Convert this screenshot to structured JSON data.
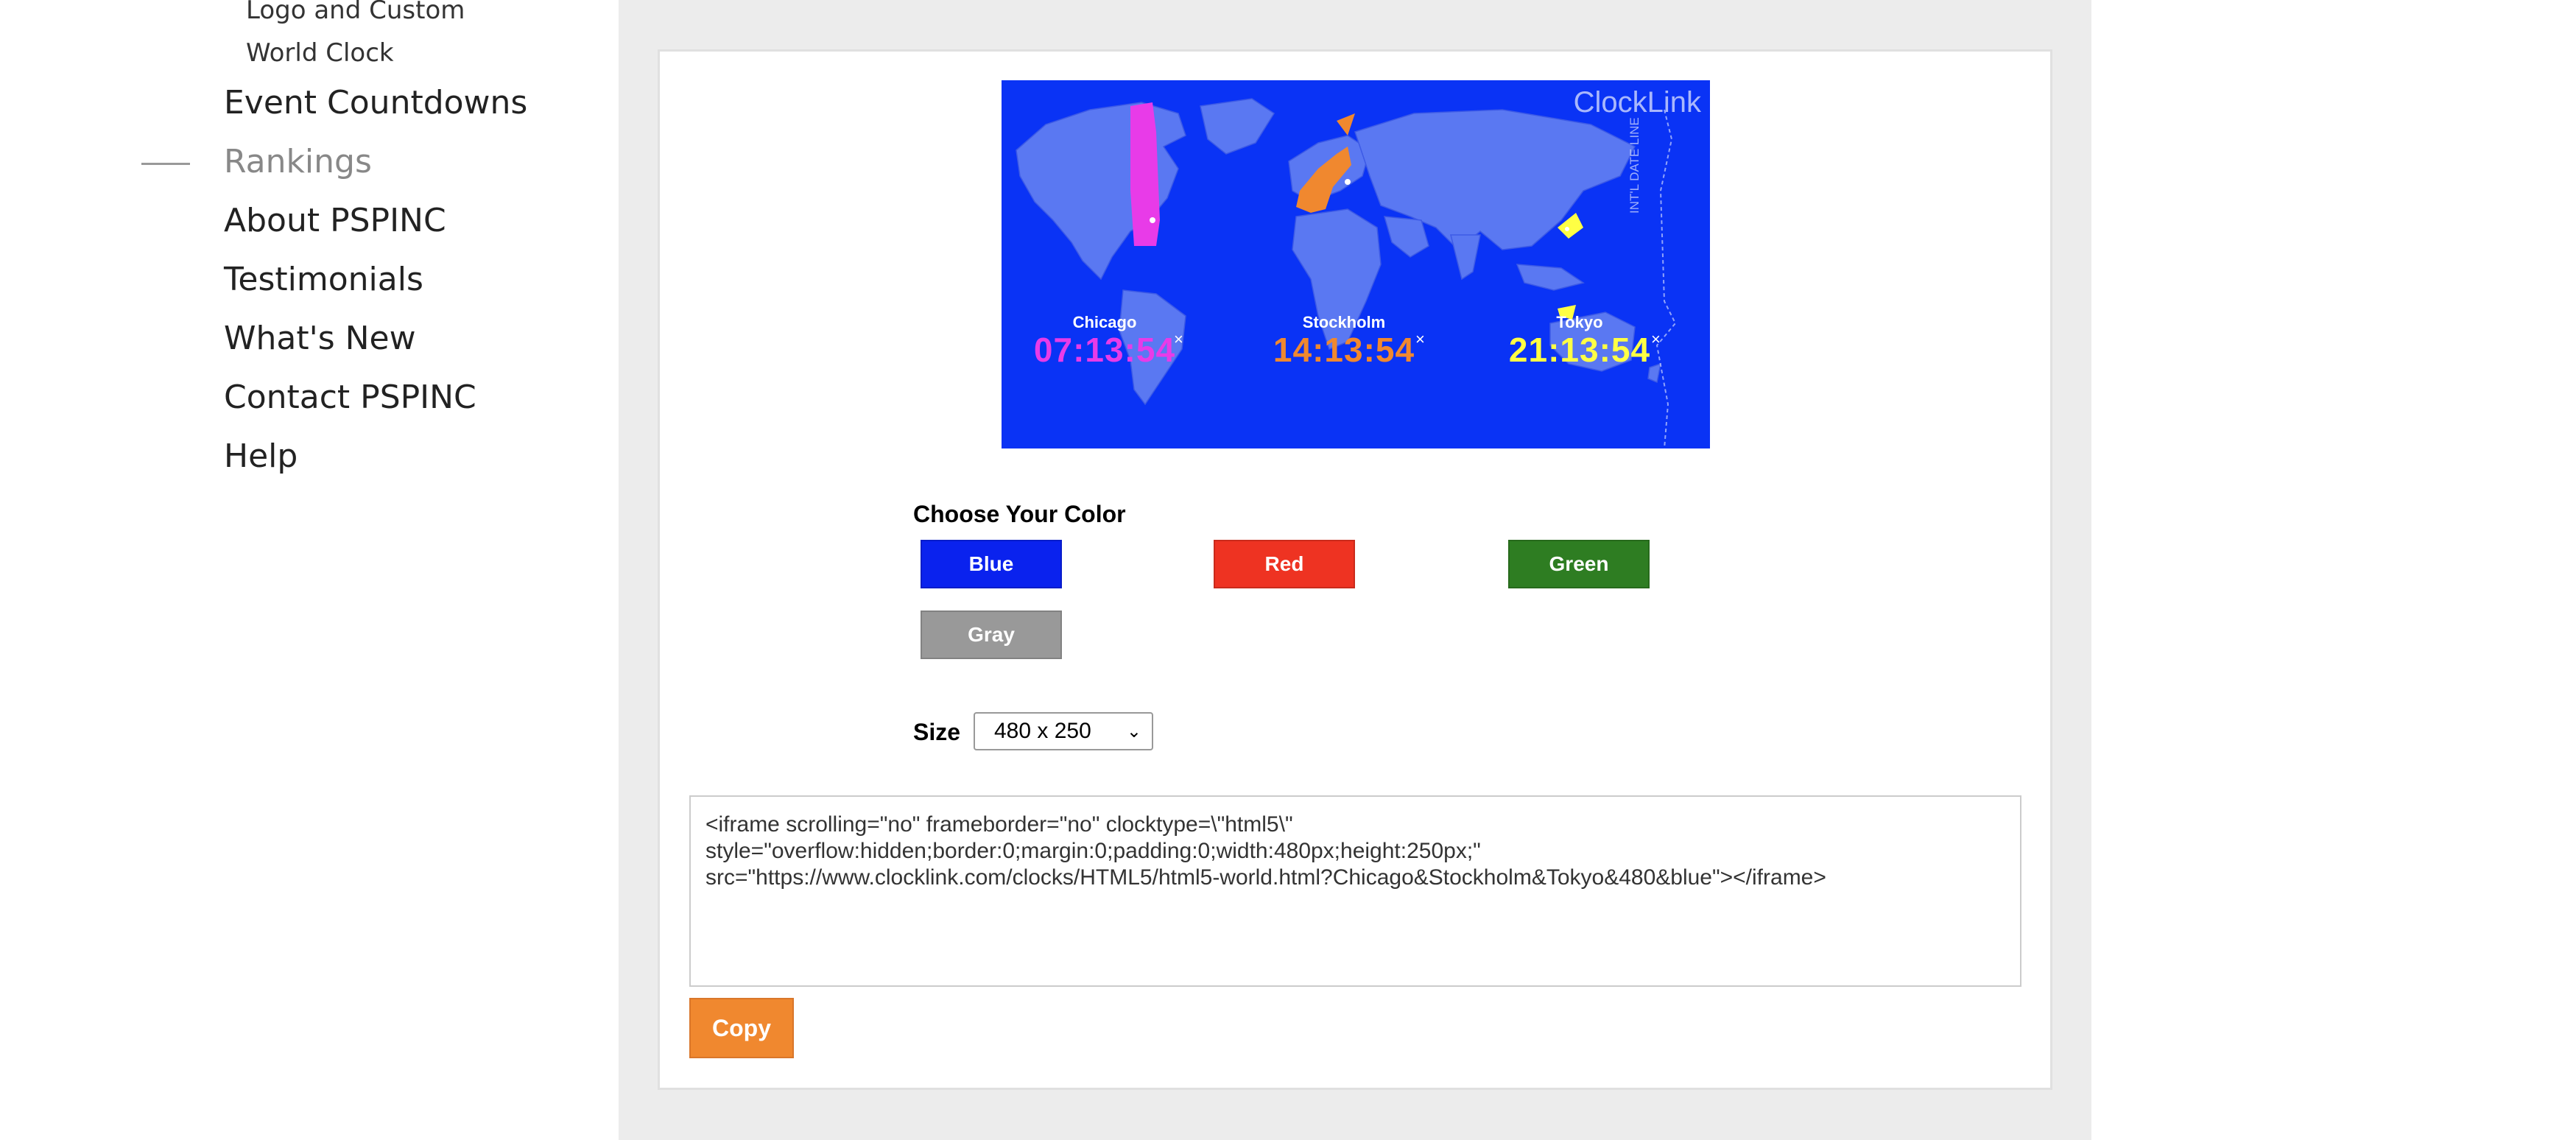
{
  "sidebar": {
    "sub_items": [
      "Logo and Custom",
      "World Clock"
    ],
    "items": [
      {
        "label": "Event Countdowns"
      },
      {
        "label": "Rankings"
      },
      {
        "label": "About PSPINC"
      },
      {
        "label": "Testimonials"
      },
      {
        "label": "What's New"
      },
      {
        "label": "Contact PSPINC"
      },
      {
        "label": "Help"
      }
    ]
  },
  "clock": {
    "brand": "ClockLink",
    "dateline_label": "INT'L DATE LINE",
    "cities": [
      {
        "name": "Chicago",
        "time": "07:13:54",
        "color": "#e83be8"
      },
      {
        "name": "Stockholm",
        "time": "14:13:54",
        "color": "#f0882f"
      },
      {
        "name": "Tokyo",
        "time": "21:13:54",
        "color": "#ffff44"
      }
    ],
    "close_mark": "×",
    "bg_color": "#0a33f5"
  },
  "chooser": {
    "label": "Choose Your Color",
    "colors": [
      {
        "label": "Blue",
        "hex": "#0a22ee"
      },
      {
        "label": "Red",
        "hex": "#ee3322"
      },
      {
        "label": "Green",
        "hex": "#2e7d22"
      },
      {
        "label": "Gray",
        "hex": "#999999"
      }
    ]
  },
  "size": {
    "label": "Size",
    "selected": "480 x 250"
  },
  "code": {
    "text": "<iframe scrolling=\"no\" frameborder=\"no\" clocktype=\\\"html5\\\"\nstyle=\"overflow:hidden;border:0;margin:0;padding:0;width:480px;height:250px;\"\nsrc=\"https://www.clocklink.com/clocks/HTML5/html5-world.html?Chicago&Stockholm&Tokyo&480&blue\"></iframe>"
  },
  "copy_label": "Copy"
}
